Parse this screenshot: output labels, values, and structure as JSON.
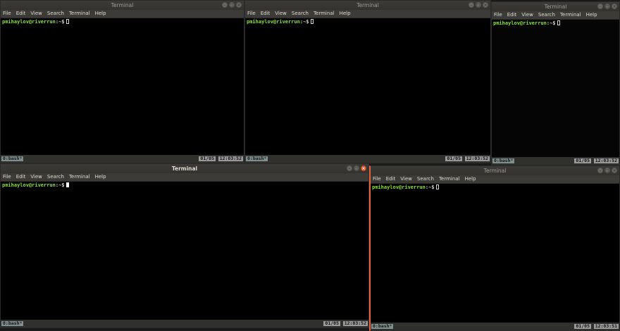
{
  "terminals": [
    {
      "title": "Terminal",
      "menu": [
        "File",
        "Edit",
        "View",
        "Search",
        "Terminal",
        "Help"
      ],
      "prompt_user": "pmihaylov@riverrun",
      "prompt_path": ":~$",
      "tab": "0:bash",
      "tab_marker": "*",
      "pages": "01/05",
      "clock": "12:03:52"
    },
    {
      "title": "Terminal",
      "menu": [
        "File",
        "Edit",
        "View",
        "Search",
        "Terminal",
        "Help"
      ],
      "prompt_user": "pmihaylov@riverrun",
      "prompt_path": ":~$",
      "tab": "0:bash",
      "tab_marker": "*",
      "pages": "01/05",
      "clock": "12:03:52"
    },
    {
      "title": "Terminal",
      "menu": [
        "File",
        "Edit",
        "View",
        "Search",
        "Terminal",
        "Help"
      ],
      "prompt_user": "pmihaylov@riverrun",
      "prompt_path": ":~$",
      "tab": "0:bash",
      "tab_marker": "*",
      "pages": "01/05",
      "clock": "12:03:52"
    },
    {
      "title": "Terminal",
      "menu": [
        "File",
        "Edit",
        "View",
        "Search",
        "Terminal",
        "Help"
      ],
      "prompt_user": "pmihaylov@riverrun",
      "prompt_path": ":~$",
      "tab": "0:bash",
      "tab_marker": "*",
      "pages": "01/05",
      "clock": "12:03:52"
    },
    {
      "title": "Terminal",
      "menu": [
        "File",
        "Edit",
        "View",
        "Search",
        "Terminal",
        "Help"
      ],
      "prompt_user": "pmihaylov@riverrun",
      "prompt_path": ":~$",
      "tab": "0:bash",
      "tab_marker": "*",
      "pages": "01/05",
      "clock": "12:03:51"
    }
  ],
  "window_buttons": {
    "minimize": "–",
    "maximize": "□",
    "close": "×"
  },
  "colors": {
    "prompt_user": "#8ae234",
    "focus_border": "#e0633a",
    "close_active": "#e6592e"
  }
}
